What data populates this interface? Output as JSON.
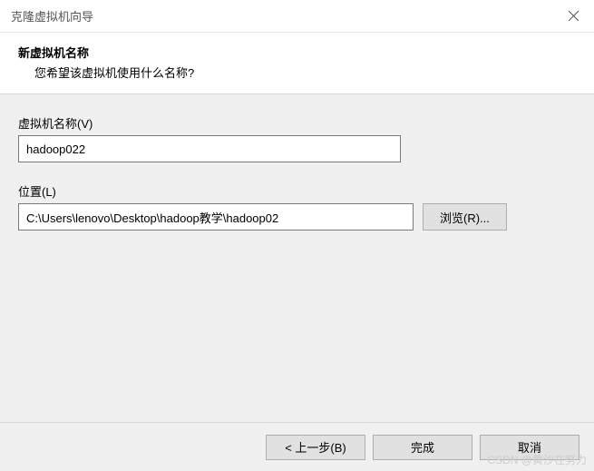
{
  "window": {
    "title": "克隆虚拟机向导"
  },
  "header": {
    "title": "新虚拟机名称",
    "description": "您希望该虚拟机使用什么名称?"
  },
  "fields": {
    "name": {
      "label": "虚拟机名称(V)",
      "value": "hadoop022"
    },
    "location": {
      "label": "位置(L)",
      "value": "C:\\Users\\lenovo\\Desktop\\hadoop教学\\hadoop02",
      "browse_label": "浏览(R)..."
    }
  },
  "footer": {
    "back_label": "< 上一步(B)",
    "finish_label": "完成",
    "cancel_label": "取消"
  },
  "watermark": "CSDN @黄沙在努力"
}
